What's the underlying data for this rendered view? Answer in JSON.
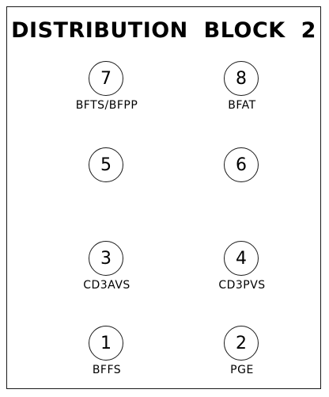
{
  "title": "DISTRIBUTION  BLOCK  2",
  "terminals": {
    "t7": {
      "number": "7",
      "label": "BFTS/BFPP"
    },
    "t8": {
      "number": "8",
      "label": "BFAT"
    },
    "t5": {
      "number": "5",
      "label": ""
    },
    "t6": {
      "number": "6",
      "label": ""
    },
    "t3": {
      "number": "3",
      "label": "CD3AVS"
    },
    "t4": {
      "number": "4",
      "label": "CD3PVS"
    },
    "t1": {
      "number": "1",
      "label": "BFFS"
    },
    "t2": {
      "number": "2",
      "label": "PGE"
    }
  }
}
